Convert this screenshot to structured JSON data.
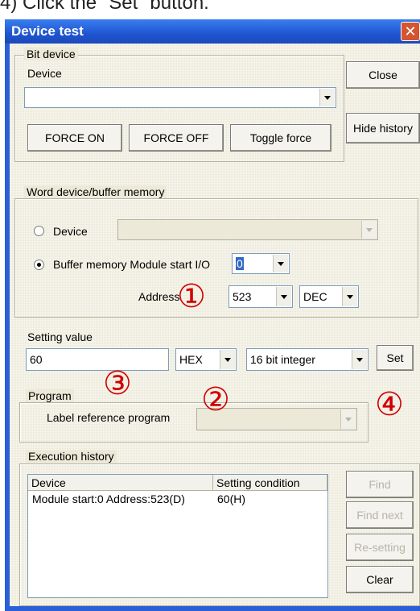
{
  "caption": "4) Click the \"Set\" button.",
  "window": {
    "title": "Device test",
    "close_glyph": "✕"
  },
  "bit_device": {
    "legend": "Bit device",
    "device_label": "Device",
    "device_value": "",
    "force_on": "FORCE ON",
    "force_off": "FORCE OFF",
    "toggle_force": "Toggle force"
  },
  "side_buttons": {
    "close": "Close",
    "hide_history": "Hide history"
  },
  "word_device": {
    "legend": "Word device/buffer memory",
    "radio_device_label": "Device",
    "radio_device_selected": false,
    "device_value": "",
    "radio_buffer_label": "Buffer memory Module start I/O",
    "radio_buffer_selected": true,
    "module_start_io": "0",
    "address_label": "Address",
    "address_value": "523",
    "address_format": "DEC"
  },
  "setting_value": {
    "label": "Setting value",
    "value": "60",
    "radix": "HEX",
    "data_type": "16 bit integer",
    "set_button": "Set"
  },
  "program": {
    "legend": "Program",
    "label_ref": "Label reference program",
    "value": ""
  },
  "execution_history": {
    "legend": "Execution history",
    "columns": [
      "Device",
      "Setting condition"
    ],
    "rows": [
      {
        "device": "Module start:0 Address:523(D)",
        "condition": "60(H)"
      }
    ],
    "find": "Find",
    "find_next": "Find next",
    "resetting": "Re-setting",
    "clear": "Clear"
  },
  "annotations": {
    "one": "①",
    "two": "②",
    "three": "③",
    "four": "④"
  },
  "colors": {
    "title_bar": "#1f55d0",
    "annotation_red": "#d00000",
    "selection": "#316ac5"
  }
}
